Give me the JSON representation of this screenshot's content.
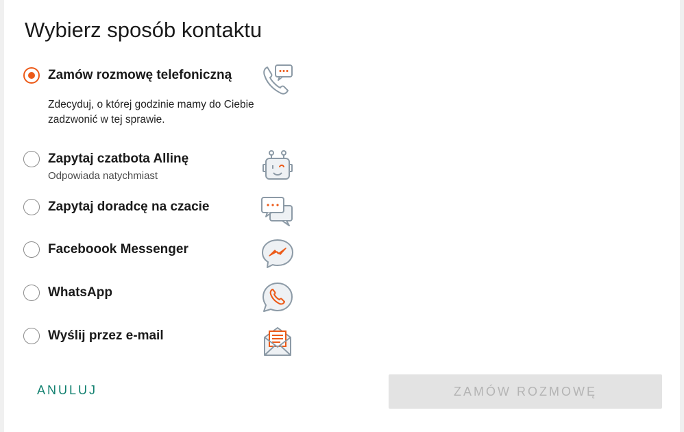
{
  "dialog": {
    "title": "Wybierz sposób kontaktu",
    "options": [
      {
        "label": "Zamów rozmowę telefoniczną",
        "description": "Zdecyduj, o której godzinie mamy do Ciebie zadzwonić w tej sprawie.",
        "selected": true,
        "icon": "phone-chat-icon"
      },
      {
        "label": "Zapytaj czatbota Allinę",
        "subtext": "Odpowiada natychmiast",
        "selected": false,
        "icon": "chatbot-robot-icon"
      },
      {
        "label": "Zapytaj doradcę na czacie",
        "selected": false,
        "icon": "chat-bubbles-icon"
      },
      {
        "label": "Faceboook Messenger",
        "selected": false,
        "icon": "messenger-icon"
      },
      {
        "label": "WhatsApp",
        "selected": false,
        "icon": "whatsapp-icon"
      },
      {
        "label": "Wyślij przez e-mail",
        "selected": false,
        "icon": "email-envelope-icon"
      }
    ],
    "cancel_label": "ANULUJ",
    "submit_label": "ZAMÓW ROZMOWĘ",
    "submit_disabled": true
  },
  "colors": {
    "accent": "#ec5a18",
    "link": "#0f7f6e",
    "icon_gray": "#8c9aa6",
    "disabled_bg": "#e3e3e3",
    "disabled_text": "#b4b4b4"
  }
}
